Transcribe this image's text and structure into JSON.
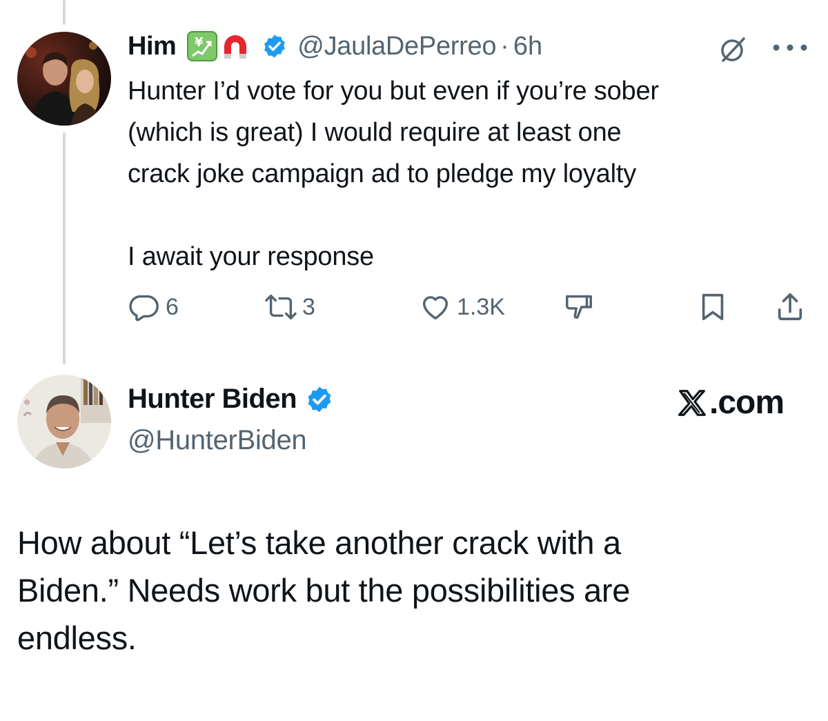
{
  "colors": {
    "text_primary": "#0f1419",
    "text_secondary": "#536471",
    "verified_blue": "#1d9bf0",
    "thread_line": "#cfd9de"
  },
  "tweet_reply": {
    "author_name": "Him",
    "name_emojis": [
      "yen-chart-emoji",
      "magnet-emoji"
    ],
    "verified": true,
    "handle": "@JaulaDePerreo",
    "separator": "·",
    "time": "6h",
    "lines": [
      "Hunter I’d vote for you but even if you’re sober",
      "(which is great) I would require at least one",
      "crack joke campaign ad to pledge my loyalty",
      "I await your response"
    ],
    "actions": {
      "reply_count": "6",
      "retweet_count": "3",
      "like_count": "1.3K"
    }
  },
  "tweet_main": {
    "author_name": "Hunter Biden",
    "verified": true,
    "handle": "@HunterBiden",
    "source_logo_text": ".com",
    "text_lines": [
      "How about “Let’s take another crack with a",
      "Biden.” Needs work but the possibilities are",
      "endless."
    ]
  }
}
